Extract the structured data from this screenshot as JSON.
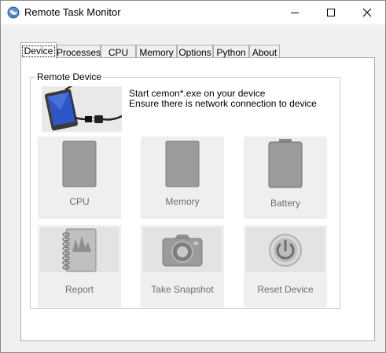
{
  "window": {
    "title": "Remote Task Monitor"
  },
  "tabs": [
    {
      "label": "Device",
      "active": true
    },
    {
      "label": "Processes",
      "active": false
    },
    {
      "label": "CPU",
      "active": false
    },
    {
      "label": "Memory",
      "active": false
    },
    {
      "label": "Options",
      "active": false
    },
    {
      "label": "Python",
      "active": false
    },
    {
      "label": "About",
      "active": false
    }
  ],
  "device": {
    "group_label": "Remote Device",
    "instructions": [
      "Start cemon*.exe on your device",
      "Ensure there is network connection to device"
    ],
    "tiles": [
      {
        "label": "CPU",
        "icon": "cpu-gauge-icon"
      },
      {
        "label": "Memory",
        "icon": "memory-gauge-icon"
      },
      {
        "label": "Battery",
        "icon": "battery-icon"
      },
      {
        "label": "Report",
        "icon": "report-notebook-icon"
      },
      {
        "label": "Take Snapshot",
        "icon": "camera-icon"
      },
      {
        "label": "Reset Device",
        "icon": "power-icon"
      }
    ]
  }
}
